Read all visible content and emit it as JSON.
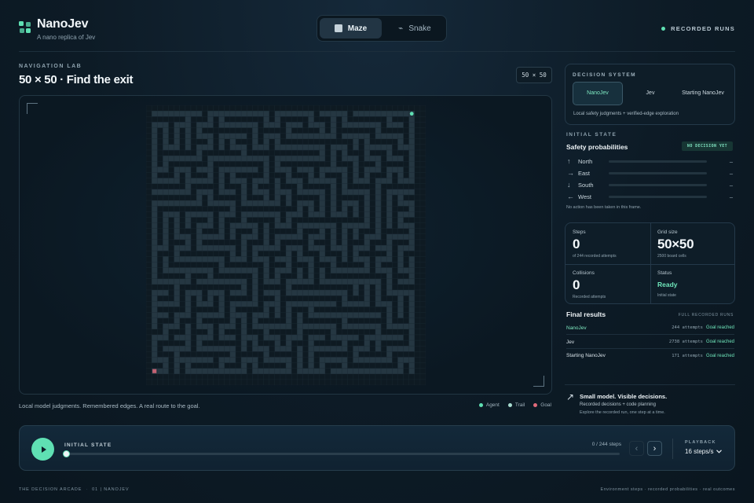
{
  "brand": {
    "name": "NanoJev",
    "tagline": "A nano replica of Jev"
  },
  "modes": [
    {
      "label": "Maze",
      "icon": "square-icon",
      "active": true
    },
    {
      "label": "Snake",
      "icon": "snake-icon",
      "active": false
    }
  ],
  "header": {
    "recorded_runs": "RECORDED RUNS"
  },
  "lab": {
    "eyebrow": "NAVIGATION LAB",
    "title": "50 × 50 · Find the exit",
    "size_chip": "50 × 50",
    "caption": "Local model judgments. Remembered edges. A real route to the goal.",
    "legend": [
      {
        "label": "Agent",
        "color": "#5fe0b3"
      },
      {
        "label": "Trail",
        "color": "#a8dcd0"
      },
      {
        "label": "Goal",
        "color": "#e06a7a"
      }
    ]
  },
  "maze": {
    "grid": 50,
    "wall_color": "#0e1a22",
    "path_color": "#253742",
    "agent_color": "#5fe0b3",
    "goal_color": "#e06a7a"
  },
  "decision_system": {
    "label": "DECISION SYSTEM",
    "options": [
      "NanoJev",
      "Jev",
      "Starting NanoJev"
    ],
    "active": "NanoJev",
    "note": "Local safety judgments + verified-edge exploration"
  },
  "state": {
    "eyebrow": "INITIAL STATE",
    "safety_title": "Safety probabilities",
    "badge": "NO DECISION YET",
    "directions": [
      {
        "arrow": "↑",
        "name": "North",
        "value": "–",
        "icon": "arrow-up-icon"
      },
      {
        "arrow": "→",
        "name": "East",
        "value": "–",
        "icon": "arrow-right-icon"
      },
      {
        "arrow": "↓",
        "name": "South",
        "value": "–",
        "icon": "arrow-down-icon"
      },
      {
        "arrow": "←",
        "name": "West",
        "value": "–",
        "icon": "arrow-left-icon"
      }
    ],
    "no_action": "No action has been taken in this frame."
  },
  "stats": {
    "steps": {
      "label": "Steps",
      "value": "0",
      "sub": "of 244 recorded attempts"
    },
    "grid": {
      "label": "Grid size",
      "value": "50×50",
      "sub": "2500 board cells"
    },
    "collisions": {
      "label": "Collisions",
      "value": "0",
      "sub": "Recorded attempts"
    },
    "status": {
      "label": "Status",
      "value": "Ready",
      "sub": "Initial state"
    }
  },
  "final": {
    "title": "Final results",
    "subtitle": "FULL RECORDED RUNS",
    "rows": [
      {
        "name": "NanoJev",
        "attempts": "244 attempts",
        "result": "Goal reached",
        "highlight": true
      },
      {
        "name": "Jev",
        "attempts": "2738 attempts",
        "result": "Goal reached",
        "highlight": false
      },
      {
        "name": "Starting NanoJev",
        "attempts": "171 attempts",
        "result": "Goal reached",
        "highlight": false
      }
    ]
  },
  "promo": {
    "title": "Small model. Visible decisions.",
    "line1": "Recorded decisions + code planning",
    "line2": "Explore the recorded run, one step at a time."
  },
  "player": {
    "state_label": "INITIAL STATE",
    "progress_text": "0 / 244 steps",
    "progress": 0,
    "playback_label": "PLAYBACK",
    "speed": "16 steps/s"
  },
  "footer": {
    "left_a": "THE DECISION ARCADE",
    "left_b": "01 | NANOJEV",
    "right": "Environment steps · recorded probabilities · real outcomes"
  }
}
